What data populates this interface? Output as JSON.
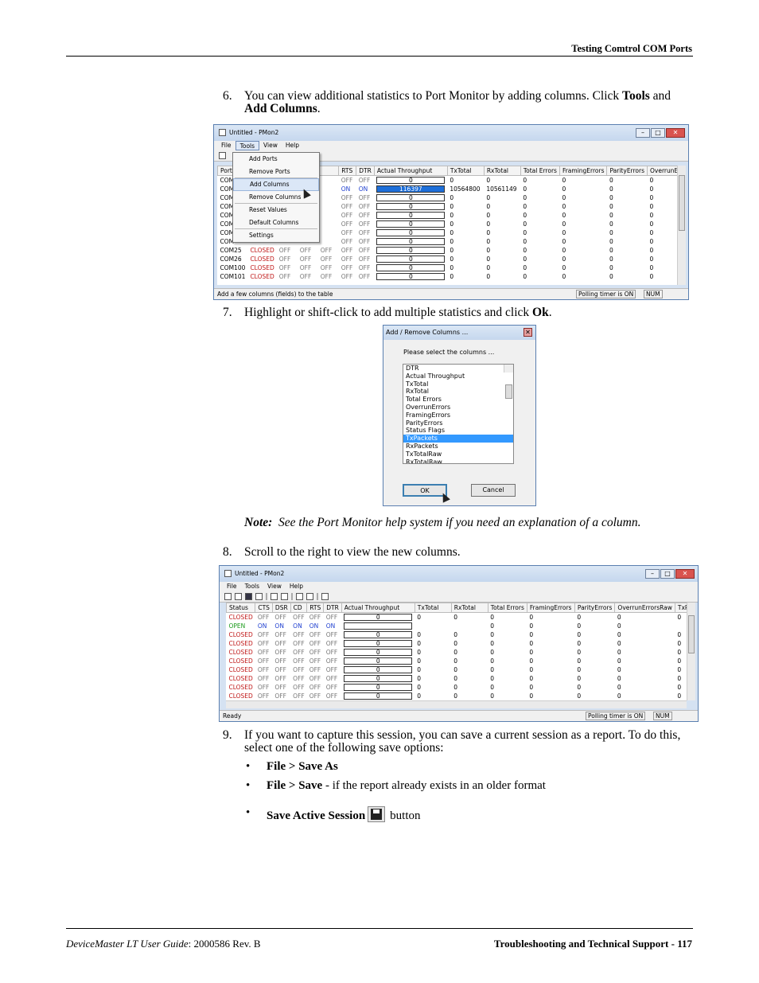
{
  "header": {
    "title": "Testing Comtrol COM Ports"
  },
  "steps": {
    "s6": {
      "num": "6.",
      "text_before": "You can view additional statistics to Port Monitor by adding columns. Click ",
      "bold1": "Tools",
      "mid": " and ",
      "bold2": "Add Columns",
      "end": "."
    },
    "s7": {
      "num": "7.",
      "text_before": "Highlight or shift-click to add multiple statistics and click ",
      "bold1": "Ok",
      "end": "."
    },
    "s8": {
      "num": "8.",
      "text": "Scroll to the right to view the new columns."
    },
    "s9": {
      "num": "9.",
      "text": "If you want to capture this session, you can save a current session as a report. To do this, select one of the following save options:"
    }
  },
  "note": {
    "label": "Note:",
    "text": "See the Port Monitor help system if you need an explanation of a column."
  },
  "bullets": [
    {
      "dot": "•",
      "bold": "File > Save As",
      "rest": ""
    },
    {
      "dot": "•",
      "bold": "File > Save",
      "rest": " - if the report already exists in an older format"
    },
    {
      "dot": "•",
      "bold": "Save Active Session",
      "rest": "button"
    }
  ],
  "window1": {
    "title": "Untitled - PMon2",
    "menu": [
      "File",
      "Tools",
      "View",
      "Help"
    ],
    "columns": [
      "Port",
      "",
      "",
      "",
      "",
      "RTS",
      "DTR",
      "Actual Throughput",
      "TxTotal",
      "RxTotal",
      "Total Errors",
      "FramingErrors",
      "ParityErrors",
      "OverrunErrorsRaw"
    ],
    "tools_menu": [
      "Add Ports",
      "Remove Ports",
      "Add Columns",
      "Remove Columns",
      "Reset Values",
      "Default Columns",
      "Settings"
    ],
    "status": "Add a few columns (fields) to the table",
    "polling": "Polling timer is ON",
    "num": "NUM"
  },
  "dialog": {
    "title": "Add / Remove Columns ...",
    "prompt": "Please select the columns ...",
    "items": [
      "DTR",
      "Actual Throughput",
      "TxTotal",
      "RxTotal",
      "Total Errors",
      "OverrunErrors",
      "FramingErrors",
      "ParityErrors",
      "Status Flags",
      "TxPackets",
      "RxPackets",
      "TxTotalRaw",
      "RxTotalRaw"
    ],
    "selected": "TxPackets",
    "ok": "OK",
    "cancel": "Cancel"
  },
  "window2": {
    "title": "Untitled - PMon2",
    "menu": [
      "File",
      "Tools",
      "View",
      "Help"
    ],
    "columns": [
      "Status",
      "CTS",
      "DSR",
      "CD",
      "RTS",
      "DTR",
      "Actual Throughput",
      "TxTotal",
      "RxTotal",
      "Total Errors",
      "FramingErrors",
      "ParityErrors",
      "OverrunErrorsRaw",
      "TxPackets"
    ],
    "status": "Ready",
    "polling": "Polling timer is ON",
    "num": "NUM"
  },
  "footer": {
    "book": "DeviceMaster LT User Guide",
    "rev": ": 2000586 Rev. B",
    "section": "Troubleshooting and Technical Support  - 117"
  },
  "colors": {
    "on": "#2040d0",
    "closed": "#c01818",
    "open": "#1a9a1a",
    "highlight": "#3399ff"
  }
}
